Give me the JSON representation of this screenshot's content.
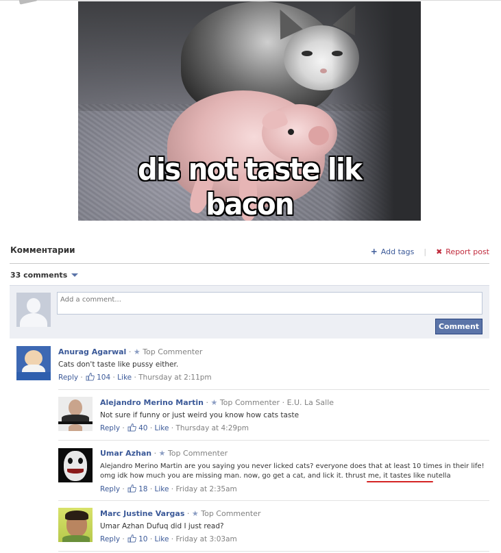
{
  "meme": {
    "caption": "dis not taste lik bacon"
  },
  "header": {
    "title": "Комментарии",
    "add_tags": "Add tags",
    "separator": "|",
    "report_post": "Report post"
  },
  "comment_count": "33 comments",
  "composer": {
    "placeholder": "Add a comment...",
    "button": "Comment"
  },
  "comments": [
    {
      "name": "Anurag Agarwal",
      "badge": "Top Commenter",
      "affiliation": "",
      "text": [
        "Cats don't taste like pussy either."
      ],
      "reply": "Reply",
      "likes": "104",
      "like": "Like",
      "time": "Thursday at 2:11pm"
    },
    {
      "name": "Alejandro Merino Martin",
      "badge": "Top Commenter",
      "affiliation": "E.U. La Salle",
      "text": [
        "Not sure if funny or just weird you know how cats taste"
      ],
      "reply": "Reply",
      "likes": "40",
      "like": "Like",
      "time": "Thursday at 4:29pm"
    },
    {
      "name": "Umar Azhan",
      "badge": "Top Commenter",
      "affiliation": "",
      "text": [
        "Alejandro Merino Martin are you saying you never licked cats? everyone does that at least 10 times in their life!",
        "omg idk how much you are missing man. now, go get a cat, and lick it. thrust me, it tastes like nutella"
      ],
      "reply": "Reply",
      "likes": "18",
      "like": "Like",
      "time": "Friday at 2:35am"
    },
    {
      "name": "Marc Justine Vargas",
      "badge": "Top Commenter",
      "affiliation": "",
      "text": [
        "Umar Azhan Dufuq did I just read?"
      ],
      "reply": "Reply",
      "likes": "10",
      "like": "Like",
      "time": "Friday at 3:03am"
    }
  ],
  "colors": {
    "link": "#3b5998",
    "report": "#c0293b",
    "button": "#5b74a8",
    "highlight_underline": "#d42222"
  },
  "icons": [
    "plus-icon",
    "x-icon",
    "caret-down-icon",
    "star-icon",
    "thumbs-up-icon"
  ]
}
